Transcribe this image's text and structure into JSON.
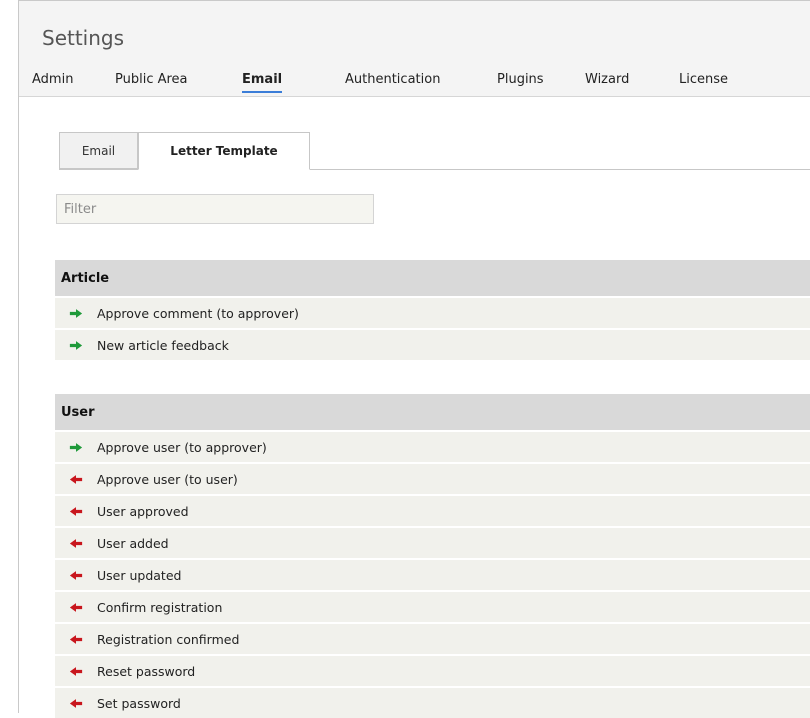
{
  "page": {
    "title": "Settings"
  },
  "nav": [
    {
      "label": "Admin",
      "active": false
    },
    {
      "label": "Public Area",
      "active": false
    },
    {
      "label": "Email",
      "active": true
    },
    {
      "label": "Authentication",
      "active": false
    },
    {
      "label": "Plugins",
      "active": false
    },
    {
      "label": "Wizard",
      "active": false
    },
    {
      "label": "License",
      "active": false
    }
  ],
  "subtabs": [
    {
      "label": "Email",
      "active": false
    },
    {
      "label": "Letter Template",
      "active": true
    }
  ],
  "filter": {
    "placeholder": "Filter",
    "value": ""
  },
  "colors": {
    "arrow_green": "#1f9a3a",
    "arrow_red": "#c8161d",
    "active_underline": "#3b7dd8"
  },
  "sections": [
    {
      "title": "Article",
      "items": [
        {
          "label": "Approve comment (to approver)",
          "icon": "arrow-right-icon",
          "color": "green"
        },
        {
          "label": "New article feedback",
          "icon": "arrow-right-icon",
          "color": "green"
        }
      ]
    },
    {
      "title": "User",
      "items": [
        {
          "label": "Approve user (to approver)",
          "icon": "arrow-right-icon",
          "color": "green"
        },
        {
          "label": "Approve user (to user)",
          "icon": "arrow-left-icon",
          "color": "red"
        },
        {
          "label": "User approved",
          "icon": "arrow-left-icon",
          "color": "red"
        },
        {
          "label": "User added",
          "icon": "arrow-left-icon",
          "color": "red"
        },
        {
          "label": "User updated",
          "icon": "arrow-left-icon",
          "color": "red"
        },
        {
          "label": "Confirm registration",
          "icon": "arrow-left-icon",
          "color": "red"
        },
        {
          "label": "Registration confirmed",
          "icon": "arrow-left-icon",
          "color": "red"
        },
        {
          "label": "Reset password",
          "icon": "arrow-left-icon",
          "color": "red"
        },
        {
          "label": "Set password",
          "icon": "arrow-left-icon",
          "color": "red"
        }
      ]
    }
  ]
}
